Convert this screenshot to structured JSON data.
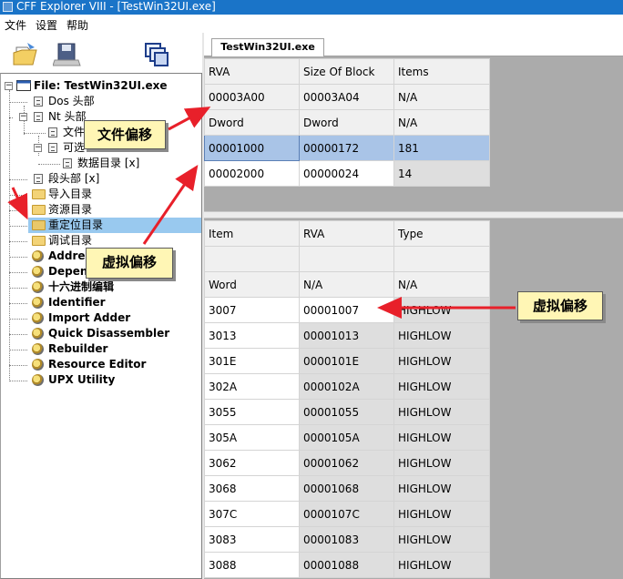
{
  "window": {
    "title": "CFF Explorer VIII - [TestWin32UI.exe]"
  },
  "menu": [
    "文件",
    "设置",
    "帮助"
  ],
  "toolbar": {
    "icons": [
      "open-file-icon",
      "save-disk-icon",
      "windows-icon"
    ]
  },
  "tab": {
    "label": "TestWin32UI.exe"
  },
  "tree": {
    "root": "File: TestWin32UI.exe",
    "items": [
      {
        "label": "Dos 头部",
        "icon": "document-icon"
      },
      {
        "label": "Nt 头部",
        "icon": "document-icon"
      },
      {
        "label": "文件",
        "icon": "document-icon"
      },
      {
        "label": "可选",
        "icon": "document-icon"
      },
      {
        "label": "数据目录 [x]",
        "icon": "document-icon"
      },
      {
        "label": "段头部 [x]",
        "icon": "document-icon"
      },
      {
        "label": "导入目录",
        "icon": "folder-icon"
      },
      {
        "label": "资源目录",
        "icon": "folder-icon"
      },
      {
        "label": "重定位目录",
        "icon": "folder-icon"
      },
      {
        "label": "调试目录",
        "icon": "folder-icon"
      },
      {
        "label": "Address",
        "icon": "tool-icon"
      },
      {
        "label": "Depend",
        "icon": "tool-icon"
      },
      {
        "label": "十六进制编辑",
        "icon": "tool-icon"
      },
      {
        "label": "Identifier",
        "icon": "tool-icon"
      },
      {
        "label": "Import Adder",
        "icon": "tool-icon"
      },
      {
        "label": "Quick Disassembler",
        "icon": "tool-icon"
      },
      {
        "label": "Rebuilder",
        "icon": "tool-icon"
      },
      {
        "label": "Resource Editor",
        "icon": "tool-icon"
      },
      {
        "label": "UPX Utility",
        "icon": "tool-icon"
      }
    ]
  },
  "blocks_table": {
    "headers": [
      "RVA",
      "Size Of Block",
      "Items"
    ],
    "meta_row": [
      "00003A00",
      "00003A04",
      "N/A"
    ],
    "type_row": [
      "Dword",
      "Dword",
      "N/A"
    ],
    "rows": [
      [
        "00001000",
        "00000172",
        "181"
      ],
      [
        "00002000",
        "00000024",
        "14"
      ]
    ]
  },
  "items_table": {
    "headers": [
      "Item",
      "RVA",
      "Type"
    ],
    "type_row": [
      "Word",
      "N/A",
      "N/A"
    ],
    "rows": [
      [
        "3007",
        "00001007",
        "HIGHLOW"
      ],
      [
        "3013",
        "00001013",
        "HIGHLOW"
      ],
      [
        "301E",
        "0000101E",
        "HIGHLOW"
      ],
      [
        "302A",
        "0000102A",
        "HIGHLOW"
      ],
      [
        "3055",
        "00001055",
        "HIGHLOW"
      ],
      [
        "305A",
        "0000105A",
        "HIGHLOW"
      ],
      [
        "3062",
        "00001062",
        "HIGHLOW"
      ],
      [
        "3068",
        "00001068",
        "HIGHLOW"
      ],
      [
        "307C",
        "0000107C",
        "HIGHLOW"
      ],
      [
        "3083",
        "00001083",
        "HIGHLOW"
      ],
      [
        "3088",
        "00001088",
        "HIGHLOW"
      ]
    ]
  },
  "annotations": {
    "file_offset": "文件偏移",
    "virtual_offset_left": "虚拟偏移",
    "virtual_offset_right": "虚拟偏移"
  }
}
